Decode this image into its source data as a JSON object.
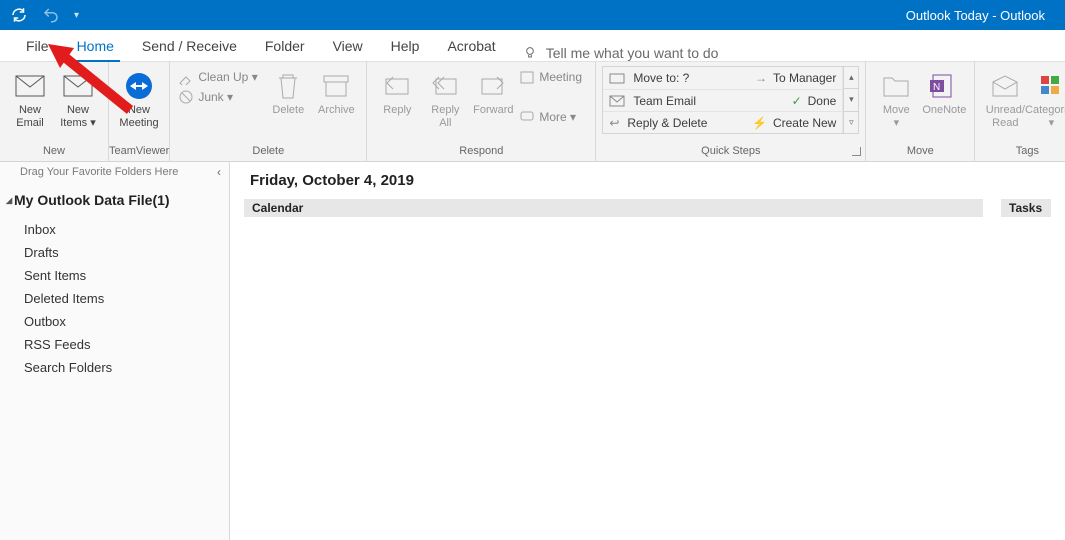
{
  "window_title": "Outlook Today  -  Outlook",
  "tabs": {
    "file": "File",
    "home": "Home",
    "send_receive": "Send / Receive",
    "folder": "Folder",
    "view": "View",
    "help": "Help",
    "acrobat": "Acrobat",
    "tell_me": "Tell me what you want to do"
  },
  "ribbon": {
    "new": {
      "email": "New\nEmail",
      "items": "New\nItems ▾",
      "group": "New"
    },
    "teamviewer": {
      "meeting": "New\nMeeting",
      "group": "TeamViewer"
    },
    "delete": {
      "cleanup": "Clean Up ▾",
      "junk": "Junk ▾",
      "delete": "Delete",
      "archive": "Archive",
      "group": "Delete"
    },
    "respond": {
      "reply": "Reply",
      "reply_all": "Reply\nAll",
      "forward": "Forward",
      "meeting": "Meeting",
      "more": "More ▾",
      "group": "Respond"
    },
    "quicksteps": {
      "move_to": "Move to: ?",
      "team_email": "Team Email",
      "reply_delete": "Reply & Delete",
      "to_manager": "To Manager",
      "done": "Done",
      "create_new": "Create New",
      "group": "Quick Steps"
    },
    "move": {
      "move": "Move\n▾",
      "onenote": "OneNote",
      "group": "Move"
    },
    "tags": {
      "unread": "Unread/\nRead",
      "categorize": "Categori…\n▾",
      "group": "Tags"
    }
  },
  "nav": {
    "drop_hint": "Drag Your Favorite Folders Here",
    "header": "My Outlook Data File(1)",
    "items": [
      "Inbox",
      "Drafts",
      "Sent Items",
      "Deleted Items",
      "Outbox",
      "RSS Feeds",
      "Search Folders"
    ]
  },
  "main": {
    "date": "Friday, October 4, 2019",
    "calendar": "Calendar",
    "tasks": "Tasks"
  }
}
